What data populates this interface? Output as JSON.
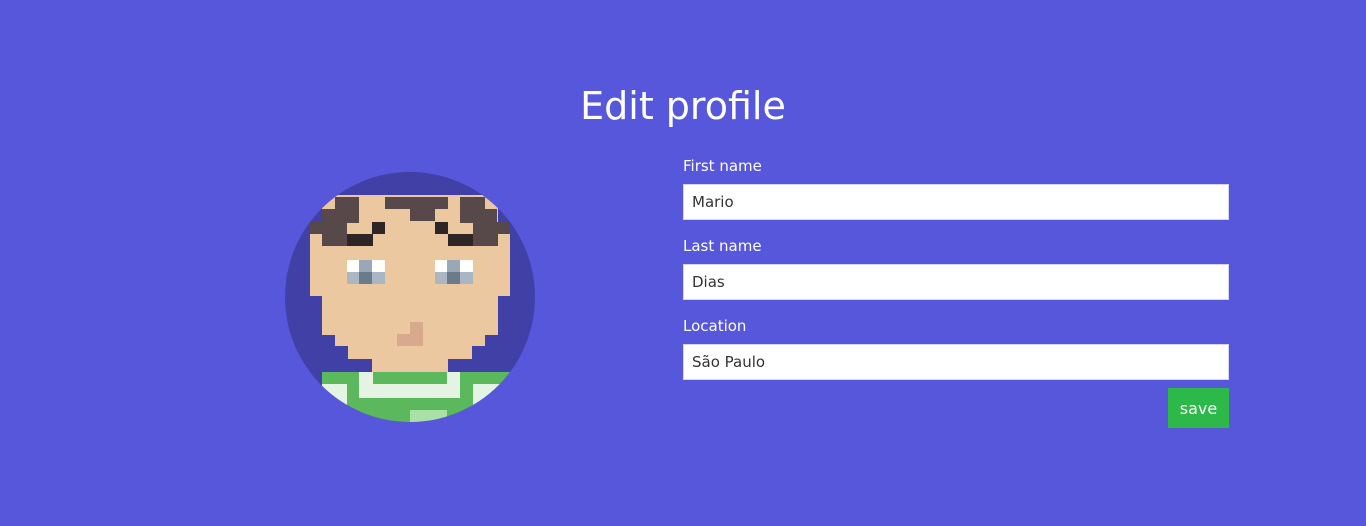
{
  "page": {
    "title": "Edit profile"
  },
  "avatar": {
    "icon": "pixel-avatar-icon",
    "background_color": "#4040a6"
  },
  "form": {
    "first_name": {
      "label": "First name",
      "value": "Mario"
    },
    "last_name": {
      "label": "Last name",
      "value": "Dias"
    },
    "location": {
      "label": "Location",
      "value": "São Paulo"
    },
    "save_label": "save"
  },
  "colors": {
    "background": "#5757db",
    "save_button": "#2db84a"
  }
}
